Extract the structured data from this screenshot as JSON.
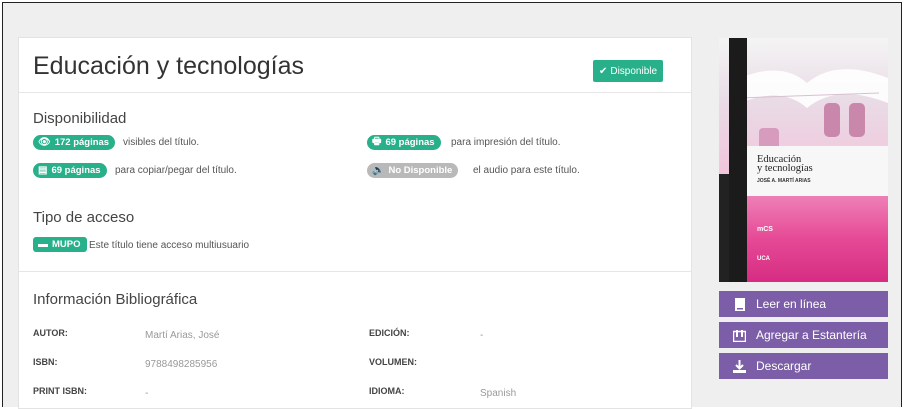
{
  "title": "Educación y tecnologías",
  "status_badge": "Disponible",
  "sections": {
    "availability": "Disponibilidad",
    "access": "Tipo de acceso",
    "biblio": "Información Bibliográfica"
  },
  "availability": {
    "visible_pages": "172 páginas",
    "visible_text": "visibles del título.",
    "print_pages": "69 páginas",
    "print_text": "para impresión del título.",
    "copy_pages": "69 páginas",
    "copy_text": "para copiar/pegar del título.",
    "audio_status": "No Disponible",
    "audio_text": "el audio para este título."
  },
  "access": {
    "badge": "MUPO",
    "text": "Este título tiene acceso multiusuario"
  },
  "biblio": {
    "author_label": "AUTOR:",
    "author_value": "Martí Arias, José",
    "edition_label": "EDICIÓN:",
    "edition_value": "-",
    "isbn_label": "ISBN:",
    "isbn_value": "9788498285956",
    "volume_label": "VOLUMEN:",
    "volume_value": "",
    "print_isbn_label": "PRINT ISBN:",
    "print_isbn_value": "-",
    "language_label": "IDIOMA:",
    "language_value": "Spanish"
  },
  "cover": {
    "title": "Educación\ny tecnologías",
    "author": "JOSÉ A. MARTÍ ARIAS",
    "series": "mCS",
    "publisher": "UCA"
  },
  "actions": {
    "read_online": "Leer en línea",
    "add_shelf": "Agregar a Estantería",
    "download": "Descargar"
  },
  "colors": {
    "green": "#27b08a",
    "gray_badge": "#b9b9b9",
    "purple": "#7b5ea7",
    "cover_pink": "#e64a96"
  }
}
